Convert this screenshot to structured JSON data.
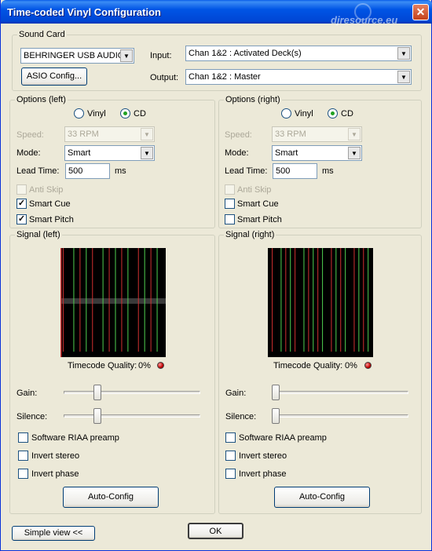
{
  "window": {
    "title": "Time-coded Vinyl Configuration",
    "watermark": "djresource.eu",
    "close_label": "✕"
  },
  "sound_card": {
    "legend": "Sound Card",
    "device": "BEHRINGER USB AUDIO",
    "asio_button": "ASIO Config...",
    "input_label": "Input:",
    "input_value": "Chan 1&2 : Activated Deck(s)",
    "output_label": "Output:",
    "output_value": "Chan 1&2 : Master"
  },
  "options_left": {
    "legend": "Options (left)",
    "vinyl_label": "Vinyl",
    "cd_label": "CD",
    "selected": "CD",
    "speed_label": "Speed:",
    "speed_value": "33 RPM",
    "mode_label": "Mode:",
    "mode_value": "Smart",
    "lead_label": "Lead Time:",
    "lead_value": "500",
    "lead_unit": "ms",
    "anti_skip": "Anti Skip",
    "anti_skip_checked": false,
    "smart_cue": "Smart Cue",
    "smart_cue_checked": true,
    "smart_pitch": "Smart Pitch",
    "smart_pitch_checked": true
  },
  "options_right": {
    "legend": "Options (right)",
    "vinyl_label": "Vinyl",
    "cd_label": "CD",
    "selected": "CD",
    "speed_label": "Speed:",
    "speed_value": "33 RPM",
    "mode_label": "Mode:",
    "mode_value": "Smart",
    "lead_label": "Lead Time:",
    "lead_value": "500",
    "lead_unit": "ms",
    "anti_skip": "Anti Skip",
    "anti_skip_checked": false,
    "smart_cue": "Smart Cue",
    "smart_cue_checked": false,
    "smart_pitch": "Smart Pitch",
    "smart_pitch_checked": false
  },
  "signal_left": {
    "legend": "Signal (left)",
    "quality_label": "Timecode Quality:",
    "quality_value": "0%",
    "gain_label": "Gain:",
    "gain_level": 0.23,
    "silence_label": "Silence:",
    "silence_level": 0.23,
    "riaa": "Software RIAA preamp",
    "invert_stereo": "Invert stereo",
    "invert_phase": "Invert phase",
    "auto_config": "Auto-Config"
  },
  "signal_right": {
    "legend": "Signal (right)",
    "quality_label": "Timecode Quality:",
    "quality_value": "0%",
    "gain_label": "Gain:",
    "gain_level": 0.0,
    "silence_label": "Silence:",
    "silence_level": 0.0,
    "riaa": "Software RIAA preamp",
    "invert_stereo": "Invert stereo",
    "invert_phase": "Invert phase",
    "auto_config": "Auto-Config"
  },
  "footer": {
    "simple_view": "Simple view <<",
    "ok": "OK"
  },
  "colors": {
    "titlebar": "#0055e5",
    "scope_bg": "#000000",
    "trace_red": "#d03030",
    "trace_green": "#50d050",
    "led": "#c00000"
  }
}
